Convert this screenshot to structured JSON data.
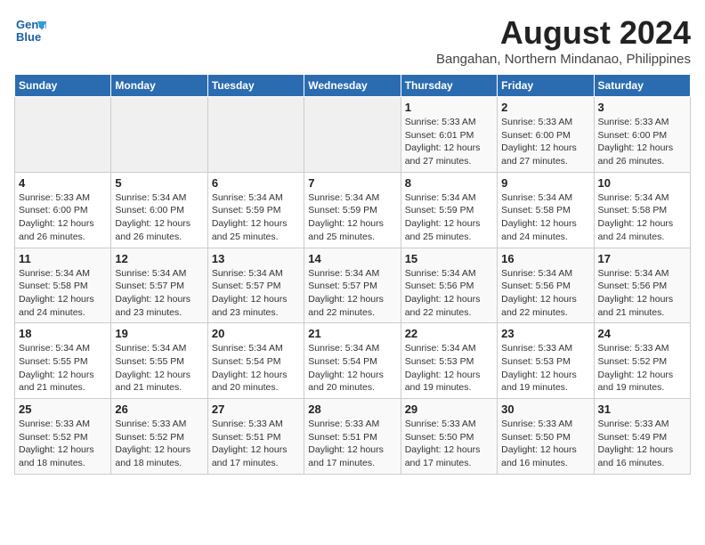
{
  "header": {
    "logo_line1": "General",
    "logo_line2": "Blue",
    "month_year": "August 2024",
    "location": "Bangahan, Northern Mindanao, Philippines"
  },
  "days_of_week": [
    "Sunday",
    "Monday",
    "Tuesday",
    "Wednesday",
    "Thursday",
    "Friday",
    "Saturday"
  ],
  "weeks": [
    [
      {
        "day": "",
        "sunrise": "",
        "sunset": "",
        "daylight": "",
        "empty": true
      },
      {
        "day": "",
        "sunrise": "",
        "sunset": "",
        "daylight": "",
        "empty": true
      },
      {
        "day": "",
        "sunrise": "",
        "sunset": "",
        "daylight": "",
        "empty": true
      },
      {
        "day": "",
        "sunrise": "",
        "sunset": "",
        "daylight": "",
        "empty": true
      },
      {
        "day": "1",
        "sunrise": "Sunrise: 5:33 AM",
        "sunset": "Sunset: 6:01 PM",
        "daylight": "Daylight: 12 hours and 27 minutes.",
        "empty": false
      },
      {
        "day": "2",
        "sunrise": "Sunrise: 5:33 AM",
        "sunset": "Sunset: 6:00 PM",
        "daylight": "Daylight: 12 hours and 27 minutes.",
        "empty": false
      },
      {
        "day": "3",
        "sunrise": "Sunrise: 5:33 AM",
        "sunset": "Sunset: 6:00 PM",
        "daylight": "Daylight: 12 hours and 26 minutes.",
        "empty": false
      }
    ],
    [
      {
        "day": "4",
        "sunrise": "Sunrise: 5:33 AM",
        "sunset": "Sunset: 6:00 PM",
        "daylight": "Daylight: 12 hours and 26 minutes.",
        "empty": false
      },
      {
        "day": "5",
        "sunrise": "Sunrise: 5:34 AM",
        "sunset": "Sunset: 6:00 PM",
        "daylight": "Daylight: 12 hours and 26 minutes.",
        "empty": false
      },
      {
        "day": "6",
        "sunrise": "Sunrise: 5:34 AM",
        "sunset": "Sunset: 5:59 PM",
        "daylight": "Daylight: 12 hours and 25 minutes.",
        "empty": false
      },
      {
        "day": "7",
        "sunrise": "Sunrise: 5:34 AM",
        "sunset": "Sunset: 5:59 PM",
        "daylight": "Daylight: 12 hours and 25 minutes.",
        "empty": false
      },
      {
        "day": "8",
        "sunrise": "Sunrise: 5:34 AM",
        "sunset": "Sunset: 5:59 PM",
        "daylight": "Daylight: 12 hours and 25 minutes.",
        "empty": false
      },
      {
        "day": "9",
        "sunrise": "Sunrise: 5:34 AM",
        "sunset": "Sunset: 5:58 PM",
        "daylight": "Daylight: 12 hours and 24 minutes.",
        "empty": false
      },
      {
        "day": "10",
        "sunrise": "Sunrise: 5:34 AM",
        "sunset": "Sunset: 5:58 PM",
        "daylight": "Daylight: 12 hours and 24 minutes.",
        "empty": false
      }
    ],
    [
      {
        "day": "11",
        "sunrise": "Sunrise: 5:34 AM",
        "sunset": "Sunset: 5:58 PM",
        "daylight": "Daylight: 12 hours and 24 minutes.",
        "empty": false
      },
      {
        "day": "12",
        "sunrise": "Sunrise: 5:34 AM",
        "sunset": "Sunset: 5:57 PM",
        "daylight": "Daylight: 12 hours and 23 minutes.",
        "empty": false
      },
      {
        "day": "13",
        "sunrise": "Sunrise: 5:34 AM",
        "sunset": "Sunset: 5:57 PM",
        "daylight": "Daylight: 12 hours and 23 minutes.",
        "empty": false
      },
      {
        "day": "14",
        "sunrise": "Sunrise: 5:34 AM",
        "sunset": "Sunset: 5:57 PM",
        "daylight": "Daylight: 12 hours and 22 minutes.",
        "empty": false
      },
      {
        "day": "15",
        "sunrise": "Sunrise: 5:34 AM",
        "sunset": "Sunset: 5:56 PM",
        "daylight": "Daylight: 12 hours and 22 minutes.",
        "empty": false
      },
      {
        "day": "16",
        "sunrise": "Sunrise: 5:34 AM",
        "sunset": "Sunset: 5:56 PM",
        "daylight": "Daylight: 12 hours and 22 minutes.",
        "empty": false
      },
      {
        "day": "17",
        "sunrise": "Sunrise: 5:34 AM",
        "sunset": "Sunset: 5:56 PM",
        "daylight": "Daylight: 12 hours and 21 minutes.",
        "empty": false
      }
    ],
    [
      {
        "day": "18",
        "sunrise": "Sunrise: 5:34 AM",
        "sunset": "Sunset: 5:55 PM",
        "daylight": "Daylight: 12 hours and 21 minutes.",
        "empty": false
      },
      {
        "day": "19",
        "sunrise": "Sunrise: 5:34 AM",
        "sunset": "Sunset: 5:55 PM",
        "daylight": "Daylight: 12 hours and 21 minutes.",
        "empty": false
      },
      {
        "day": "20",
        "sunrise": "Sunrise: 5:34 AM",
        "sunset": "Sunset: 5:54 PM",
        "daylight": "Daylight: 12 hours and 20 minutes.",
        "empty": false
      },
      {
        "day": "21",
        "sunrise": "Sunrise: 5:34 AM",
        "sunset": "Sunset: 5:54 PM",
        "daylight": "Daylight: 12 hours and 20 minutes.",
        "empty": false
      },
      {
        "day": "22",
        "sunrise": "Sunrise: 5:34 AM",
        "sunset": "Sunset: 5:53 PM",
        "daylight": "Daylight: 12 hours and 19 minutes.",
        "empty": false
      },
      {
        "day": "23",
        "sunrise": "Sunrise: 5:33 AM",
        "sunset": "Sunset: 5:53 PM",
        "daylight": "Daylight: 12 hours and 19 minutes.",
        "empty": false
      },
      {
        "day": "24",
        "sunrise": "Sunrise: 5:33 AM",
        "sunset": "Sunset: 5:52 PM",
        "daylight": "Daylight: 12 hours and 19 minutes.",
        "empty": false
      }
    ],
    [
      {
        "day": "25",
        "sunrise": "Sunrise: 5:33 AM",
        "sunset": "Sunset: 5:52 PM",
        "daylight": "Daylight: 12 hours and 18 minutes.",
        "empty": false
      },
      {
        "day": "26",
        "sunrise": "Sunrise: 5:33 AM",
        "sunset": "Sunset: 5:52 PM",
        "daylight": "Daylight: 12 hours and 18 minutes.",
        "empty": false
      },
      {
        "day": "27",
        "sunrise": "Sunrise: 5:33 AM",
        "sunset": "Sunset: 5:51 PM",
        "daylight": "Daylight: 12 hours and 17 minutes.",
        "empty": false
      },
      {
        "day": "28",
        "sunrise": "Sunrise: 5:33 AM",
        "sunset": "Sunset: 5:51 PM",
        "daylight": "Daylight: 12 hours and 17 minutes.",
        "empty": false
      },
      {
        "day": "29",
        "sunrise": "Sunrise: 5:33 AM",
        "sunset": "Sunset: 5:50 PM",
        "daylight": "Daylight: 12 hours and 17 minutes.",
        "empty": false
      },
      {
        "day": "30",
        "sunrise": "Sunrise: 5:33 AM",
        "sunset": "Sunset: 5:50 PM",
        "daylight": "Daylight: 12 hours and 16 minutes.",
        "empty": false
      },
      {
        "day": "31",
        "sunrise": "Sunrise: 5:33 AM",
        "sunset": "Sunset: 5:49 PM",
        "daylight": "Daylight: 12 hours and 16 minutes.",
        "empty": false
      }
    ]
  ]
}
